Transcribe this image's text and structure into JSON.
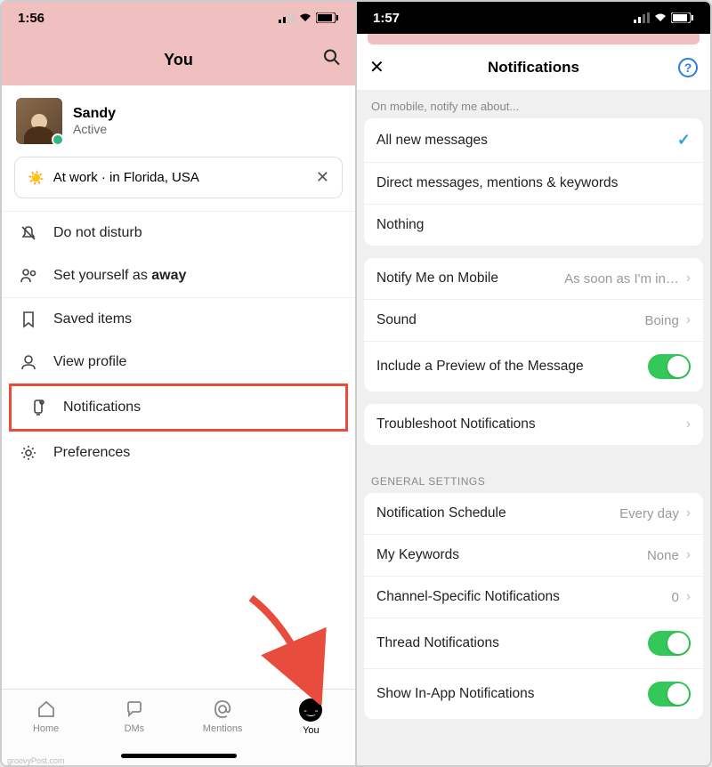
{
  "left": {
    "time": "1:56",
    "title": "You",
    "profile": {
      "name": "Sandy",
      "presence": "Active"
    },
    "status": {
      "emoji": "☀️",
      "text": "At work · in Florida, USA"
    },
    "menu": {
      "dnd": "Do not disturb",
      "away_prefix": "Set yourself as ",
      "away_bold": "away",
      "saved": "Saved items",
      "view_profile": "View profile",
      "notifications": "Notifications",
      "preferences": "Preferences"
    },
    "tabs": {
      "home": "Home",
      "dms": "DMs",
      "mentions": "Mentions",
      "you": "You"
    },
    "watermark": "groovyPost.com"
  },
  "right": {
    "time": "1:57",
    "title": "Notifications",
    "section_mobile": "On mobile, notify me about...",
    "opt_all": "All new messages",
    "opt_dm": "Direct messages, mentions & keywords",
    "opt_nothing": "Nothing",
    "notify_mobile": {
      "label": "Notify Me on Mobile",
      "value": "As soon as I'm in…"
    },
    "sound": {
      "label": "Sound",
      "value": "Boing"
    },
    "preview": "Include a Preview of the Message",
    "troubleshoot": "Troubleshoot Notifications",
    "general_header": "General Settings",
    "schedule": {
      "label": "Notification Schedule",
      "value": "Every day"
    },
    "keywords": {
      "label": "My Keywords",
      "value": "None"
    },
    "channel": {
      "label": "Channel-Specific Notifications",
      "value": "0"
    },
    "thread": "Thread Notifications",
    "inapp": "Show In-App Notifications"
  }
}
